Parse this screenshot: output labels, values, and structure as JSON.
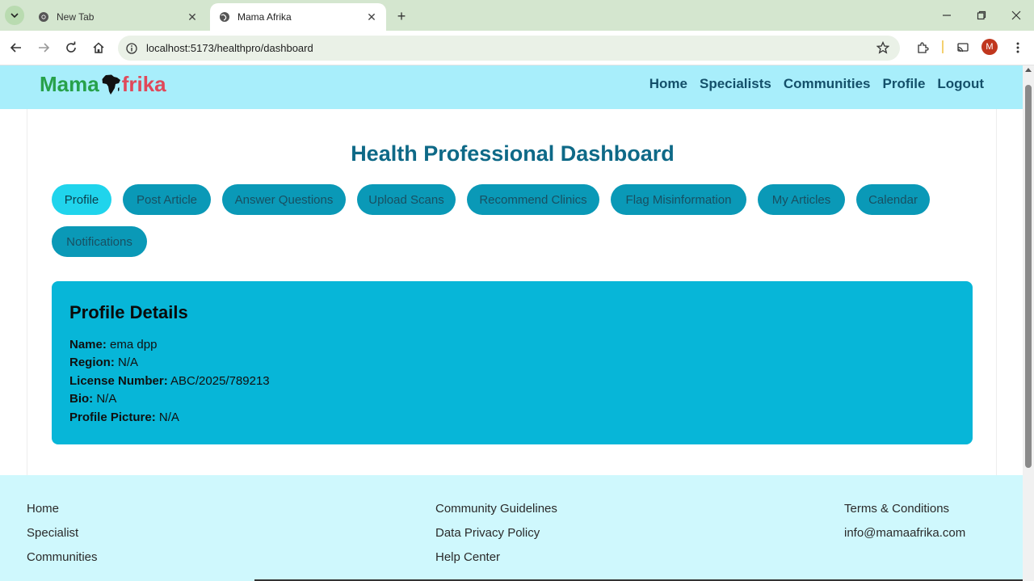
{
  "browser": {
    "tabs": [
      {
        "title": "New Tab",
        "active": false
      },
      {
        "title": "Mama Afrika",
        "active": true
      }
    ],
    "url": "localhost:5173/healthpro/dashboard",
    "profile_initial": "M"
  },
  "header": {
    "logo_part1": "Mama",
    "logo_part2": "frika",
    "nav": [
      "Home",
      "Specialists",
      "Communities",
      "Profile",
      "Logout"
    ]
  },
  "main": {
    "title": "Health Professional Dashboard",
    "tabs": [
      "Profile",
      "Post Article",
      "Answer Questions",
      "Upload Scans",
      "Recommend Clinics",
      "Flag Misinformation",
      "My Articles",
      "Calendar",
      "Notifications"
    ],
    "active_tab": "Profile",
    "profile": {
      "heading": "Profile Details",
      "fields": [
        {
          "label": "Name:",
          "value": "ema dpp"
        },
        {
          "label": "Region:",
          "value": "N/A"
        },
        {
          "label": "License Number:",
          "value": "ABC/2025/789213"
        },
        {
          "label": "Bio:",
          "value": "N/A"
        },
        {
          "label": "Profile Picture:",
          "value": "N/A"
        }
      ]
    }
  },
  "footer": {
    "col1": [
      "Home",
      "Specialist",
      "Communities"
    ],
    "col2": [
      "Community Guidelines",
      "Data Privacy Policy",
      "Help Center"
    ],
    "col3": [
      "Terms & Conditions",
      "info@mamaafrika.com"
    ]
  },
  "colors": {
    "header_bg": "#a8eefb",
    "title": "#0e6987",
    "pill": "#0a99b7",
    "pill_active": "#20d4ec",
    "panel": "#07b6d8",
    "footer_bg": "#cff8fd"
  }
}
